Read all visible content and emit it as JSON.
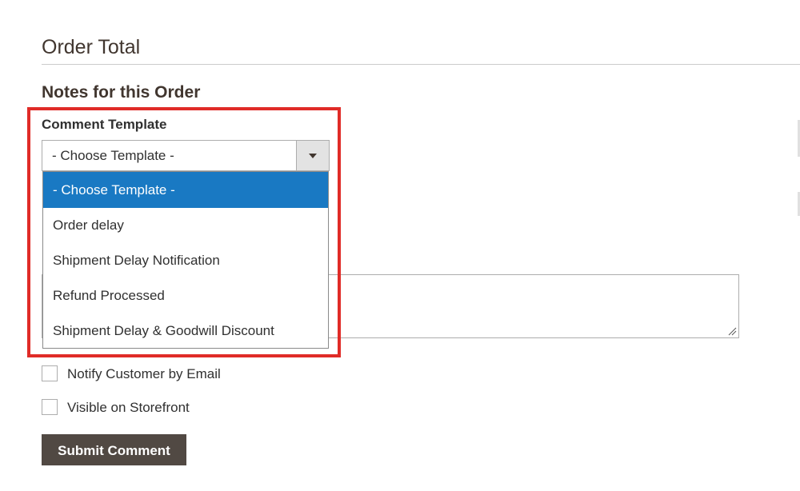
{
  "section": {
    "title": "Order Total"
  },
  "notes": {
    "title": "Notes for this Order",
    "comment_template": {
      "label": "Comment Template",
      "selected_value": "- Choose Template -",
      "options": [
        "- Choose Template -",
        "Order delay",
        "Shipment Delay Notification",
        "Refund Processed",
        "Shipment Delay & Goodwill Discount"
      ],
      "expanded": true
    },
    "comment": {
      "value": ""
    },
    "notify_customer": {
      "label": "Notify Customer by Email",
      "checked": false
    },
    "visible_storefront": {
      "label": "Visible on Storefront",
      "checked": false
    },
    "submit_label": "Submit Comment"
  },
  "colors": {
    "highlight": "#e02b27",
    "option_selected_bg": "#1979c3",
    "button_bg": "#514943",
    "heading": "#41362f"
  },
  "icons": {
    "dropdown_arrow": "chevron-down-icon",
    "textarea_resize": "resize-handle-icon"
  }
}
